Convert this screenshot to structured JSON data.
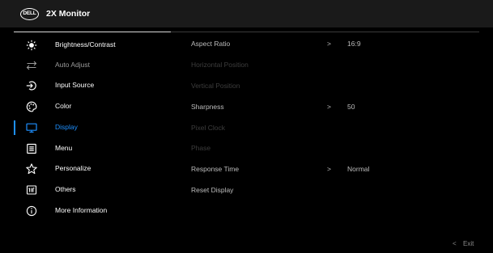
{
  "header": {
    "brand": "DELL",
    "title": "2X Monitor"
  },
  "menu": [
    {
      "label": "Brightness/Contrast",
      "icon": "sun-icon"
    },
    {
      "label": "Auto Adjust",
      "icon": "auto-adjust-arrows-icon"
    },
    {
      "label": "Input Source",
      "icon": "input-arrow-icon"
    },
    {
      "label": "Color",
      "icon": "palette-icon"
    },
    {
      "label": "Display",
      "icon": "monitor-icon"
    },
    {
      "label": "Menu",
      "icon": "menu-list-icon"
    },
    {
      "label": "Personalize",
      "icon": "star-icon"
    },
    {
      "label": "Others",
      "icon": "others-icon"
    },
    {
      "label": "More Information",
      "icon": "info-icon"
    }
  ],
  "selected_menu": "Display",
  "submenu": [
    {
      "label": "Aspect Ratio",
      "value": "16:9",
      "chevron": ">"
    },
    {
      "label": "Horizontal Position"
    },
    {
      "label": "Vertical Position"
    },
    {
      "label": "Sharpness",
      "value": "50",
      "chevron": ">"
    },
    {
      "label": "Pixel Clock"
    },
    {
      "label": "Phase"
    },
    {
      "label": "Response Time",
      "value": "Normal",
      "chevron": ">"
    },
    {
      "label": "Reset Display"
    }
  ],
  "footer": {
    "exit_label": "Exit",
    "exit_chevron": "<"
  },
  "colors": {
    "accent": "#1e90ff",
    "background": "#000000",
    "header": "#1a1a1a"
  }
}
